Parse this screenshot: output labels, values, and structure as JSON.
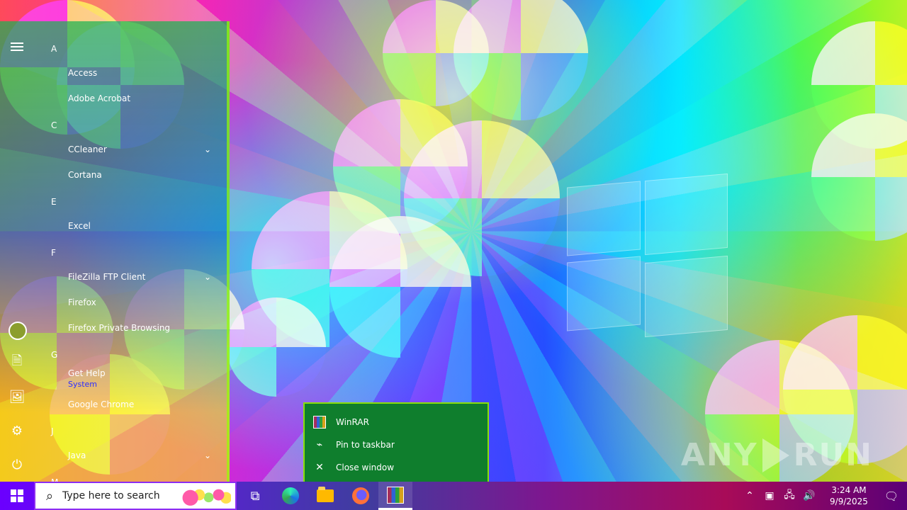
{
  "start_menu": {
    "letters": {
      "a": "A",
      "c": "C",
      "e": "E",
      "f": "F",
      "g": "G",
      "j": "J",
      "m": "M"
    },
    "apps": [
      "Access",
      "Adobe Acrobat",
      "CCleaner",
      "Cortana",
      "Excel",
      "FileZilla FTP Client",
      "Firefox",
      "Firefox Private Browsing",
      "Get Help",
      "Google Chrome",
      "Java"
    ],
    "partial_label": "System"
  },
  "context_menu": {
    "items": [
      {
        "label": "WinRAR",
        "icon": "winrar-icon"
      },
      {
        "label": "Pin to taskbar",
        "icon": "pin-icon"
      },
      {
        "label": "Close window",
        "icon": "close-icon"
      }
    ]
  },
  "taskbar": {
    "search_placeholder": "Type here to search",
    "time": "3:24 AM",
    "date": "9/9/2025"
  },
  "watermark": {
    "left": "ANY",
    "right": "RUN"
  },
  "colors": {
    "context_bg": "#0f7e2d",
    "taskbar_start": "#6b00ff",
    "search_border": "#8c2df2"
  }
}
